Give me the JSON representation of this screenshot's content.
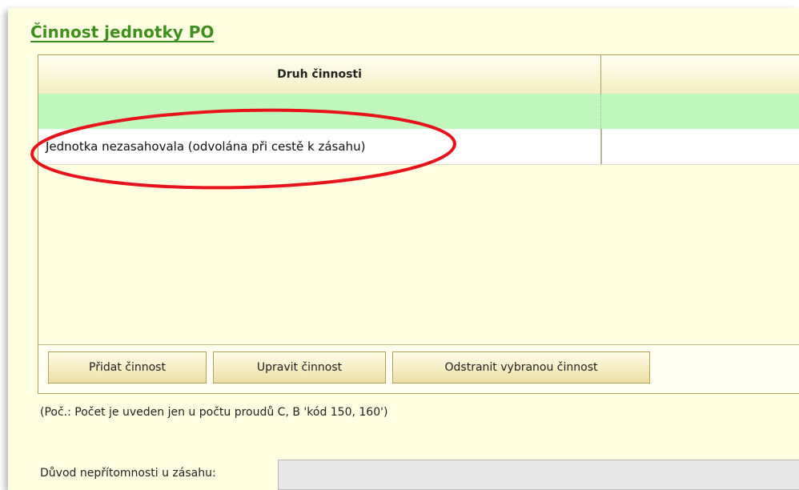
{
  "section": {
    "title": "Činnost jednotky PO"
  },
  "grid": {
    "columns": [
      "Druh činnosti",
      ""
    ],
    "rows": [
      {
        "cells": [
          "",
          ""
        ],
        "state": "selected"
      },
      {
        "cells": [
          "Jednotka nezasahovala (odvolána při cestě k zásahu)",
          ""
        ],
        "state": "normal"
      }
    ],
    "colors": {
      "selected_row": "#bff7bf",
      "panel_bg": "#ffffe1",
      "annotation": "#e8121a"
    }
  },
  "buttons": {
    "add": "Přidat činnost",
    "edit": "Upravit činnost",
    "remove": "Odstranit vybranou činnost"
  },
  "note": "(Poč.: Počet je uveden jen u počtu proudů C, B 'kód 150, 160')",
  "absence": {
    "label": "Důvod nepřítomnosti u zásahu:",
    "value": ""
  }
}
